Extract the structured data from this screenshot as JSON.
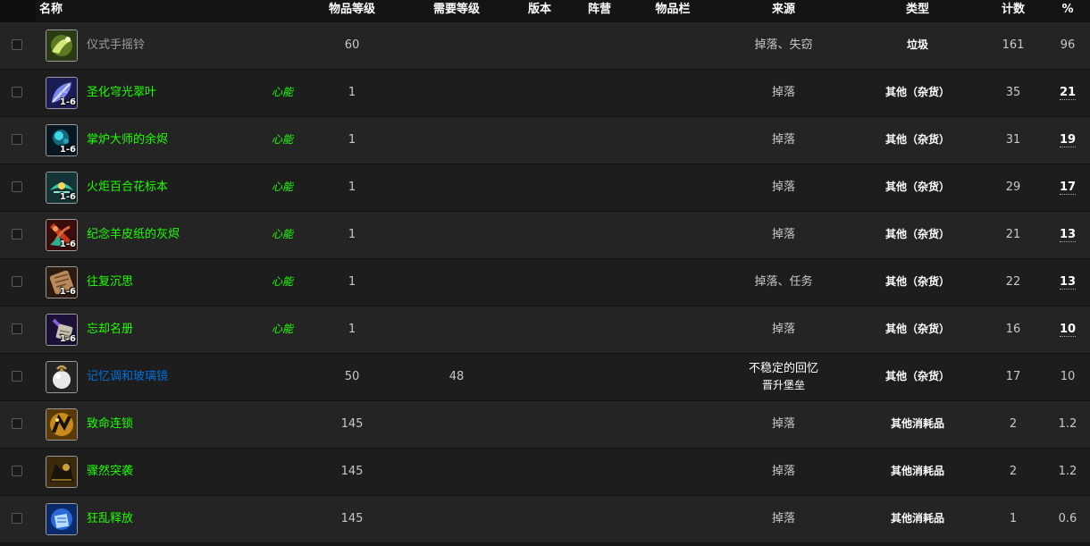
{
  "columns": {
    "name": "名称",
    "item_level": "物品等级",
    "req_level": "需要等级",
    "version": "版本",
    "faction": "阵营",
    "slot": "物品栏",
    "source": "来源",
    "type": "类型",
    "count": "计数",
    "percent": "%"
  },
  "items": [
    {
      "name": "仪式手摇铃",
      "quality": "q0",
      "tag": "",
      "badge": "",
      "icon": "handbell-icon",
      "item_level": "60",
      "req_level": "",
      "source": "掉落、失窃",
      "source_sub": "",
      "type": "垃圾",
      "count": "161",
      "percent": "96",
      "percent_dotted": false
    },
    {
      "name": "圣化穹光翠叶",
      "quality": "q2",
      "tag": "心能",
      "badge": "1-6",
      "icon": "leaf-icon",
      "item_level": "1",
      "req_level": "",
      "source": "掉落",
      "source_sub": "",
      "type": "其他（杂货）",
      "count": "35",
      "percent": "21",
      "percent_dotted": true
    },
    {
      "name": "掌炉大师的余烬",
      "quality": "q2",
      "tag": "心能",
      "badge": "1-6",
      "icon": "ember-icon",
      "item_level": "1",
      "req_level": "",
      "source": "掉落",
      "source_sub": "",
      "type": "其他（杂货）",
      "count": "31",
      "percent": "19",
      "percent_dotted": true
    },
    {
      "name": "火炬百合花标本",
      "quality": "q2",
      "tag": "心能",
      "badge": "1-6",
      "icon": "lily-icon",
      "item_level": "1",
      "req_level": "",
      "source": "掉落",
      "source_sub": "",
      "type": "其他（杂货）",
      "count": "29",
      "percent": "17",
      "percent_dotted": true
    },
    {
      "name": "纪念羊皮纸的灰烬",
      "quality": "q2",
      "tag": "心能",
      "badge": "1-6",
      "icon": "ash-icon",
      "item_level": "1",
      "req_level": "",
      "source": "掉落",
      "source_sub": "",
      "type": "其他（杂货）",
      "count": "21",
      "percent": "13",
      "percent_dotted": true
    },
    {
      "name": "往复沉思",
      "quality": "q2",
      "tag": "心能",
      "badge": "1-6",
      "icon": "scroll-icon",
      "item_level": "1",
      "req_level": "",
      "source": "掉落、任务",
      "source_sub": "",
      "type": "其他（杂货）",
      "count": "22",
      "percent": "13",
      "percent_dotted": true
    },
    {
      "name": "忘却名册",
      "quality": "q2",
      "tag": "心能",
      "badge": "1-6",
      "icon": "tome-icon",
      "item_level": "1",
      "req_level": "",
      "source": "掉落",
      "source_sub": "",
      "type": "其他（杂货）",
      "count": "16",
      "percent": "10",
      "percent_dotted": true
    },
    {
      "name": "记忆调和玻璃镜",
      "quality": "q3",
      "tag": "",
      "badge": "",
      "icon": "glass-orb-icon",
      "item_level": "50",
      "req_level": "48",
      "source": "不稳定的回忆",
      "source_sub": "晋升堡垒",
      "type": "其他（杂货）",
      "count": "17",
      "percent": "10",
      "percent_dotted": false
    },
    {
      "name": "致命连锁",
      "quality": "q2",
      "tag": "",
      "badge": "",
      "icon": "rogue-gold-icon",
      "item_level": "145",
      "req_level": "",
      "source": "掉落",
      "source_sub": "",
      "type": "其他消耗品",
      "count": "2",
      "percent": "1.2",
      "percent_dotted": false
    },
    {
      "name": "骤然突袭",
      "quality": "q2",
      "tag": "",
      "badge": "",
      "icon": "ambush-icon",
      "item_level": "145",
      "req_level": "",
      "source": "掉落",
      "source_sub": "",
      "type": "其他消耗品",
      "count": "2",
      "percent": "1.2",
      "percent_dotted": false
    },
    {
      "name": "狂乱释放",
      "quality": "q2",
      "tag": "",
      "badge": "",
      "icon": "frost-fist-icon",
      "item_level": "145",
      "req_level": "",
      "source": "掉落",
      "source_sub": "",
      "type": "其他消耗品",
      "count": "1",
      "percent": "0.6",
      "percent_dotted": false
    }
  ],
  "colors": {
    "quality_poor": "#9d9d9d",
    "quality_uncommon": "#1eff00",
    "quality_rare": "#0070dd",
    "row_odd": "#242424",
    "row_even": "#1d1d1d"
  }
}
